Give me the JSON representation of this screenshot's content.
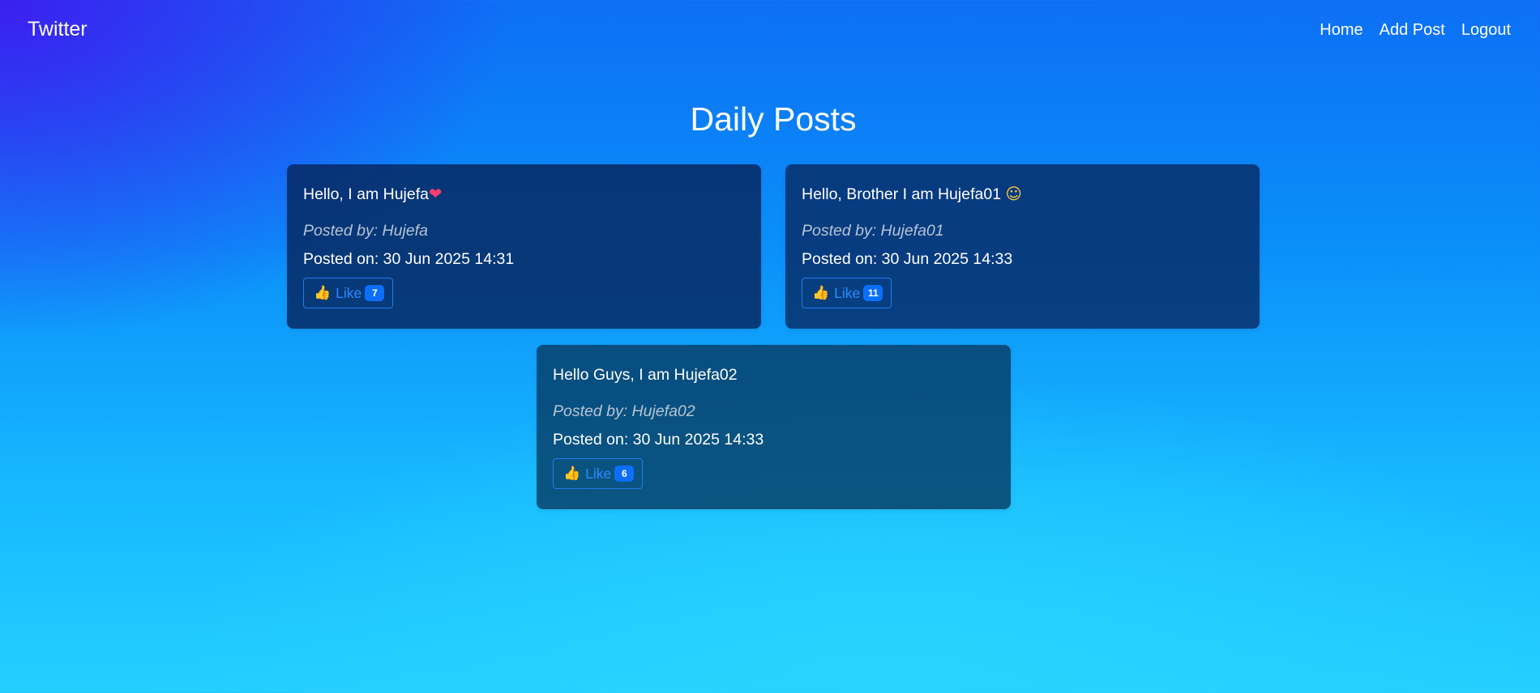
{
  "navbar": {
    "brand": "Twitter",
    "links": [
      {
        "label": "Home"
      },
      {
        "label": "Add Post"
      },
      {
        "label": "Logout"
      }
    ]
  },
  "page": {
    "title": "Daily Posts"
  },
  "posts": [
    {
      "text": "Hello, I am Hujefa",
      "emoji": "❤",
      "posted_by": "Posted by: Hujefa",
      "posted_on": "Posted on: 30 Jun 2025 14:31",
      "like_label": "Like",
      "like_count": "7"
    },
    {
      "text": "Hello, Brother I am Hujefa01",
      "emoji": "☺",
      "posted_by": "Posted by: Hujefa01",
      "posted_on": "Posted on: 30 Jun 2025 14:33",
      "like_label": "Like",
      "like_count": "11"
    },
    {
      "text": "Hello Guys, I am Hujefa02",
      "emoji": "",
      "posted_by": "Posted by: Hujefa02",
      "posted_on": "Posted on: 30 Jun 2025 14:33",
      "like_label": "Like",
      "like_count": "6"
    }
  ],
  "icons": {
    "like": "thumbs-up-icon",
    "heart": "heart-icon",
    "smile": "smile-icon"
  },
  "colors": {
    "primary": "#0b6efd",
    "card_background": "#06285e"
  }
}
